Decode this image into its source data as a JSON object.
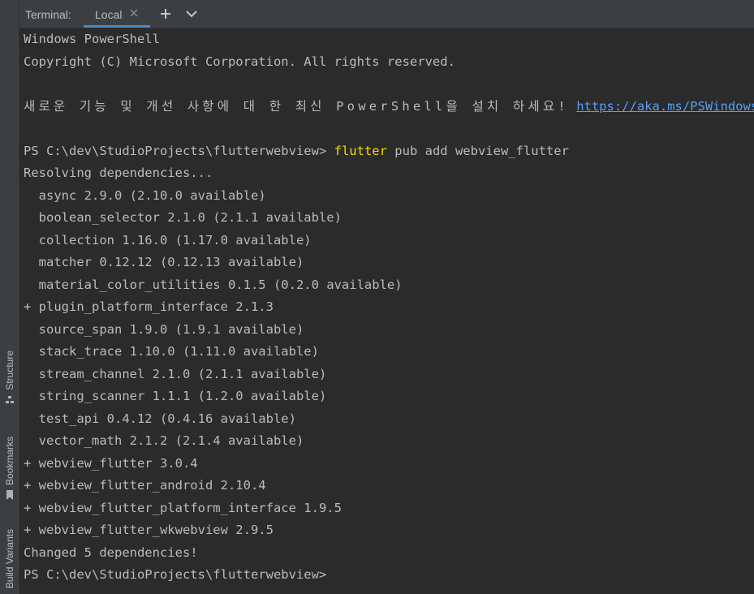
{
  "side_tabs": {
    "structure": "Structure",
    "bookmarks": "Bookmarks",
    "build_variants": "Build Variants"
  },
  "tabbar": {
    "title": "Terminal:",
    "active_tab": "Local",
    "close_glyph": "×",
    "add_glyph": "+",
    "menu_icon": "chevron-down-icon"
  },
  "terminal": {
    "header1": "Windows PowerShell",
    "header2": "Copyright (C) Microsoft Corporation. All rights reserved.",
    "notice_text": "새로운 기능 및 개선 사항에 대 한 최신 PowerShell을 설치 하세요!",
    "notice_link": "https://aka.ms/PSWindows",
    "prompt": "PS C:\\dev\\StudioProjects\\flutterwebview>",
    "command_exe": "flutter",
    "command_args": "pub add webview_flutter",
    "resolving": "Resolving dependencies...",
    "deps": [
      "  async 2.9.0 (2.10.0 available)",
      "  boolean_selector 2.1.0 (2.1.1 available)",
      "  collection 1.16.0 (1.17.0 available)",
      "  matcher 0.12.12 (0.12.13 available)",
      "  material_color_utilities 0.1.5 (0.2.0 available)",
      "+ plugin_platform_interface 2.1.3",
      "  source_span 1.9.0 (1.9.1 available)",
      "  stack_trace 1.10.0 (1.11.0 available)",
      "  stream_channel 2.1.0 (2.1.1 available)",
      "  string_scanner 1.1.1 (1.2.0 available)",
      "  test_api 0.4.12 (0.4.16 available)",
      "  vector_math 2.1.2 (2.1.4 available)",
      "+ webview_flutter 3.0.4",
      "+ webview_flutter_android 2.10.4",
      "+ webview_flutter_platform_interface 1.9.5",
      "+ webview_flutter_wkwebview 2.9.5"
    ],
    "changed": "Changed 5 dependencies!",
    "final_prompt": "PS C:\\dev\\StudioProjects\\flutterwebview>"
  },
  "colors": {
    "background": "#2b2b2b",
    "text": "#bbbbbb",
    "command": "#f5d900",
    "link": "#589df6",
    "tab_underline": "#4a88c7"
  }
}
